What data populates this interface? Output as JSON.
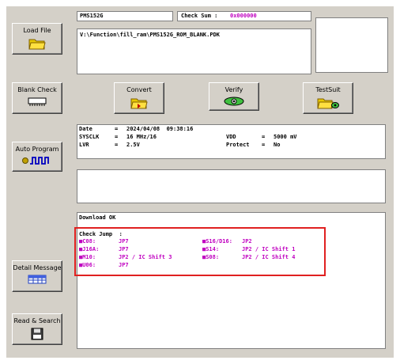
{
  "header": {
    "ic_name": "PMS152G",
    "checksum_label": "Check Sum :",
    "checksum_value": "0x000000",
    "file_path": "V:\\Function\\fill_ram\\PMS152G_ROM_BLANK.PDK"
  },
  "buttons": {
    "load_file": "Load File",
    "blank_check": "Blank Check",
    "convert": "Convert",
    "verify": "Verify",
    "testsuit": "TestSuit",
    "auto_program": "Auto Program",
    "detail_message": "Detail Message",
    "read_search": "Read & Search"
  },
  "info": {
    "date_label": "Date",
    "date_value": "2024/04/08  09:38:16",
    "sysclk_label": "SYSCLK",
    "sysclk_value": "16 MHz/16",
    "lvr_label": "LVR",
    "lvr_value": "2.5V",
    "vdd_label": "VDD",
    "vdd_value": "5000 mV",
    "protect_label": "Protect",
    "protect_value": "No",
    "eq": "="
  },
  "log": {
    "download_status": "Download OK",
    "check_jump_title": "Check Jump  :",
    "left_items": [
      {
        "pin": "■C08:",
        "value": "JP7"
      },
      {
        "pin": "■J16A:",
        "value": "JP7"
      },
      {
        "pin": "■M10:",
        "value": "JP2 / IC Shift 3"
      },
      {
        "pin": "■U06:",
        "value": "JP7"
      }
    ],
    "right_items": [
      {
        "pin": "■S16/D16:",
        "value": "JP2"
      },
      {
        "pin": "■S14:",
        "value": "JP2 / IC Shift 1"
      },
      {
        "pin": "■S08:",
        "value": "JP2 / IC Shift 4"
      }
    ]
  },
  "colors": {
    "accent_pink": "#c000c0",
    "highlight_red": "#e02020",
    "panel_gray": "#d4d0c8"
  }
}
